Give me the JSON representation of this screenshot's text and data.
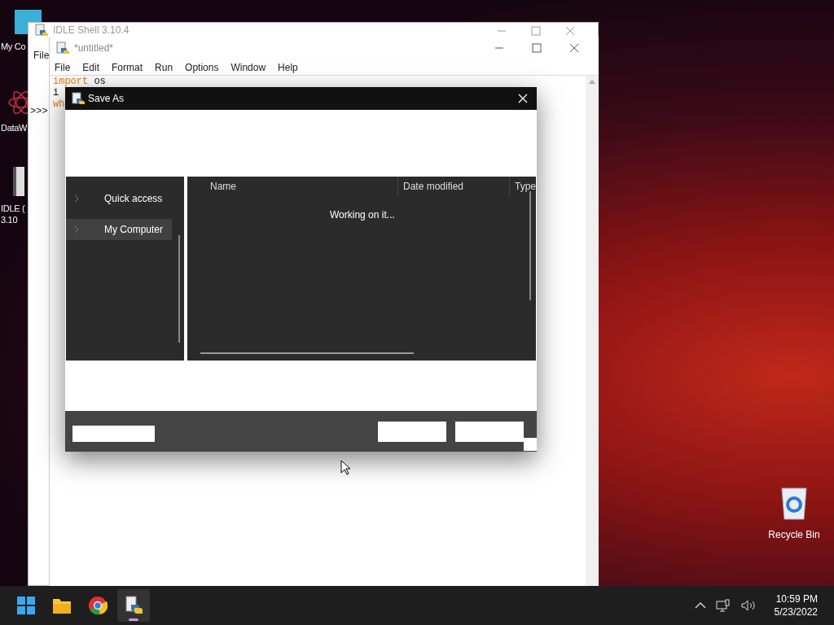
{
  "desktop_icons": [
    {
      "kind": "monitor",
      "lines": [
        "My Co"
      ]
    },
    {
      "kind": "molecule",
      "lines": [
        "DataW"
      ]
    },
    {
      "kind": "file",
      "lines": [
        "IDLE (",
        "3.10"
      ]
    }
  ],
  "recycle_bin": {
    "label": "Recycle Bin"
  },
  "shell_window": {
    "title": "IDLE Shell 3.10.4",
    "menu": [
      "File"
    ],
    "prompt": ">>>"
  },
  "editor_window": {
    "title": "*untitled*",
    "menu": [
      "File",
      "Edit",
      "Format",
      "Run",
      "Options",
      "Window",
      "Help"
    ],
    "code": [
      [
        {
          "kind": "keyword",
          "text": "import"
        },
        {
          "kind": "plain",
          "text": " os"
        }
      ],
      [
        {
          "kind": "plain",
          "text": "i"
        }
      ],
      [
        {
          "kind": "keyword",
          "text": "wh"
        }
      ]
    ]
  },
  "save_dialog": {
    "title": "Save As",
    "nav": [
      {
        "label": "Quick access",
        "selected": false
      },
      {
        "label": "My Computer",
        "selected": true
      }
    ],
    "columns": [
      "Name",
      "Date modified",
      "Type"
    ],
    "status": "Working on it..."
  },
  "taskbar": {
    "apps": [
      {
        "kind": "start",
        "selected": false
      },
      {
        "kind": "folder",
        "selected": false
      },
      {
        "kind": "chrome",
        "selected": false
      },
      {
        "kind": "idle",
        "selected": true
      }
    ],
    "time": "10:59 PM",
    "date": "5/23/2022"
  }
}
